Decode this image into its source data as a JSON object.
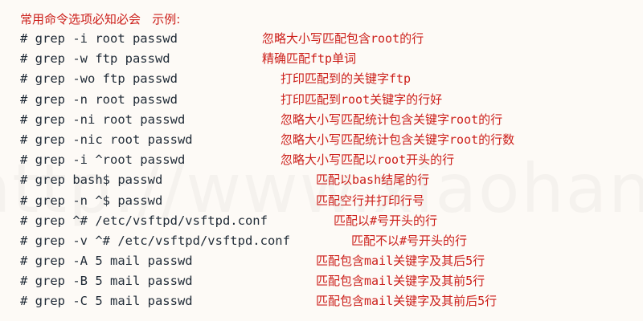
{
  "header": {
    "title": "常用命令选项必知必会   示例:"
  },
  "watermark": "http://www.xiaohanxue.com",
  "colors": {
    "command": "#1f2a36",
    "description": "#cc1f1a",
    "background": "#fdfaf6"
  },
  "rows": [
    {
      "command": "# grep -i root passwd",
      "description": "忽略大小写匹配包含root的行"
    },
    {
      "command": "# grep -w ftp passwd",
      "description": "精确匹配ftp单词"
    },
    {
      "command": "# grep -wo ftp passwd",
      "description": "打印匹配到的关键字ftp"
    },
    {
      "command": "# grep -n root passwd",
      "description": "打印匹配到root关键字的行好"
    },
    {
      "command": "# grep -ni root passwd",
      "description": "忽略大小写匹配统计包含关键字root的行"
    },
    {
      "command": "# grep -nic root passwd",
      "description": "忽略大小写匹配统计包含关键字root的行数"
    },
    {
      "command": "# grep -i ^root passwd",
      "description": "忽略大小写匹配以root开头的行"
    },
    {
      "command": "# grep bash$ passwd",
      "description": "匹配以bash结尾的行"
    },
    {
      "command": "# grep -n ^$ passwd",
      "description": "匹配空行并打印行号"
    },
    {
      "command": "# grep ^# /etc/vsftpd/vsftpd.conf",
      "description": "匹配以#号开头的行"
    },
    {
      "command": "# grep -v ^# /etc/vsftpd/vsftpd.conf",
      "description": "匹配不以#号开头的行"
    },
    {
      "command": "# grep -A 5 mail passwd",
      "description": "匹配包含mail关键字及其后5行"
    },
    {
      "command": "# grep -B 5 mail passwd",
      "description": "匹配包含mail关键字及其前5行"
    },
    {
      "command": "# grep -C 5 mail passwd",
      "description": "匹配包含mail关键字及其前后5行"
    }
  ]
}
